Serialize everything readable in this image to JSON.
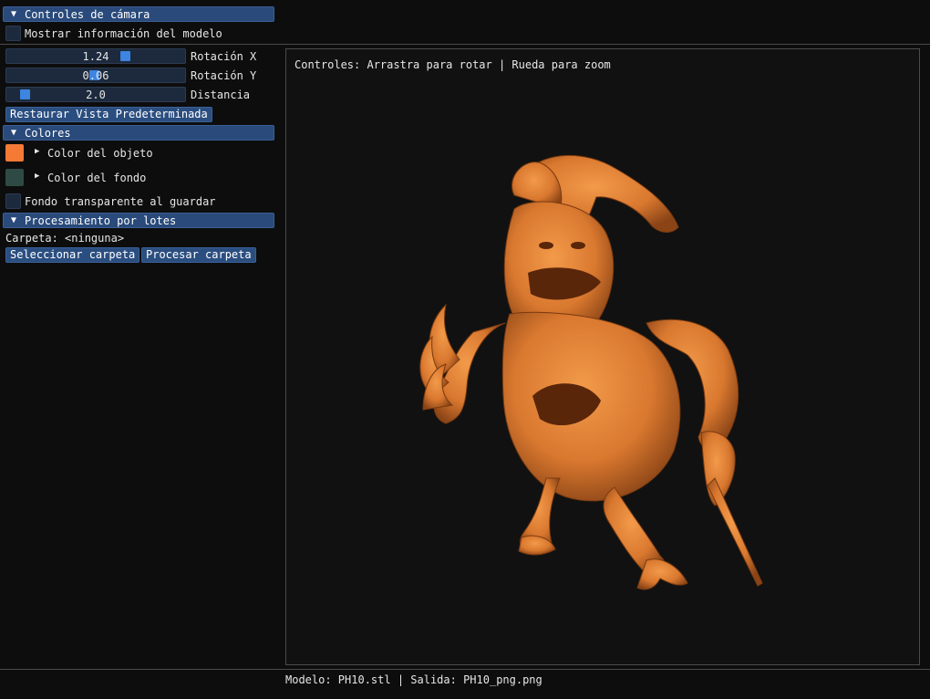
{
  "sections": {
    "camera": "Controles de cámara",
    "colors": "Colores",
    "batch": "Procesamiento por lotes"
  },
  "show_model_info": "Mostrar información del modelo",
  "sliders": [
    {
      "label": "Rotación X",
      "value": "1.24",
      "fraction": 0.68
    },
    {
      "label": "Rotación Y",
      "value": "0.06",
      "fraction": 0.49
    },
    {
      "label": "Distancia",
      "value": "2.0",
      "fraction": 0.07
    }
  ],
  "reset_button": "Restaurar Vista Predeterminada",
  "colors": {
    "object_label": "Color del objeto",
    "object_color": "#f47a36",
    "background_label": "Color del fondo",
    "background_color": "#2f4a44"
  },
  "transparent_bg": "Fondo transparente al guardar",
  "batch": {
    "folder_text": "Carpeta: <ninguna>",
    "select_button": "Seleccionar carpeta",
    "process_button": "Procesar carpeta"
  },
  "viewport": {
    "controls_hint": "Controles: Arrastra para rotar | Rueda para zoom",
    "model_color": "#d9782f"
  },
  "status": "Modelo: PH10.stl | Salida: PH10_png.png"
}
